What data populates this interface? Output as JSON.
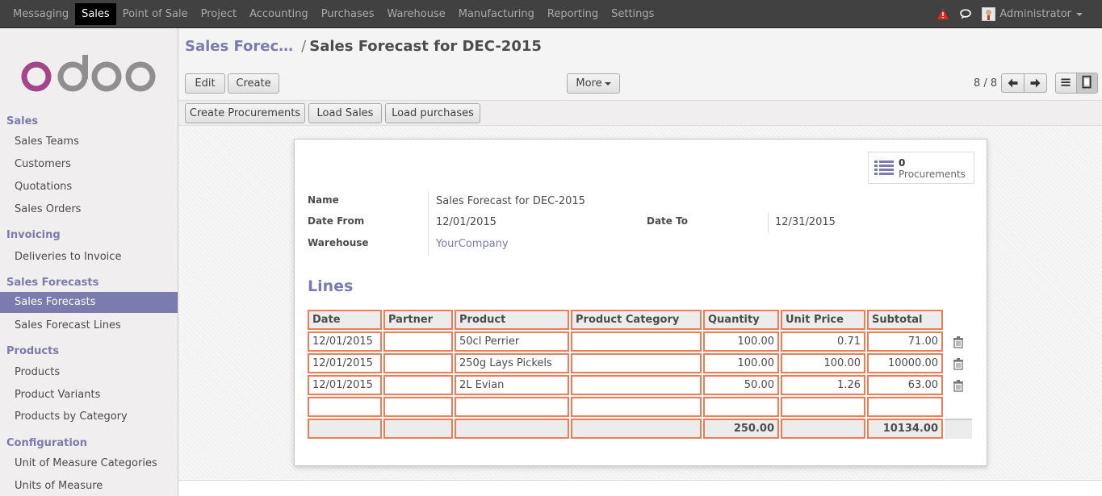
{
  "top_menu": {
    "items": [
      "Messaging",
      "Sales",
      "Point of Sale",
      "Project",
      "Accounting",
      "Purchases",
      "Warehouse",
      "Manufacturing",
      "Reporting",
      "Settings"
    ],
    "active": "Sales",
    "user": "Administrator"
  },
  "sidebar": {
    "sections": [
      {
        "title": "Sales",
        "items": [
          "Sales Teams",
          "Customers",
          "Quotations",
          "Sales Orders"
        ]
      },
      {
        "title": "Invoicing",
        "items": [
          "Deliveries to Invoice"
        ]
      },
      {
        "title": "Sales Forecasts",
        "items": [
          "Sales Forecasts",
          "Sales Forecast Lines"
        ]
      },
      {
        "title": "Products",
        "items": [
          "Products",
          "Product Variants",
          "Products by Category"
        ]
      },
      {
        "title": "Configuration",
        "items": [
          "Unit of Measure Categories",
          "Units of Measure"
        ]
      }
    ],
    "active_item": "Sales Forecasts"
  },
  "breadcrumb": {
    "parent": "Sales Forec…",
    "separator": "/",
    "current": "Sales Forecast for DEC-2015"
  },
  "toolbar": {
    "edit_label": "Edit",
    "create_label": "Create",
    "more_label": "More",
    "pager": "8 / 8"
  },
  "actions": {
    "create_procurements": "Create Procurements",
    "load_sales": "Load Sales",
    "load_purchases": "Load purchases"
  },
  "stat_button": {
    "count": "0",
    "label": "Procurements"
  },
  "form": {
    "name_label": "Name",
    "name_value": "Sales Forecast for DEC-2015",
    "date_from_label": "Date From",
    "date_from_value": "12/01/2015",
    "date_to_label": "Date To",
    "date_to_value": "12/31/2015",
    "warehouse_label": "Warehouse",
    "warehouse_value": "YourCompany"
  },
  "lines": {
    "title": "Lines",
    "columns": [
      "Date",
      "Partner",
      "Product",
      "Product Category",
      "Quantity",
      "Unit Price",
      "Subtotal"
    ],
    "rows": [
      {
        "date": "12/01/2015",
        "partner": "",
        "product": "50cl Perrier",
        "category": "",
        "quantity": "100.00",
        "unit_price": "0.71",
        "subtotal": "71.00"
      },
      {
        "date": "12/01/2015",
        "partner": "",
        "product": "250g Lays Pickels",
        "category": "",
        "quantity": "100.00",
        "unit_price": "100.00",
        "subtotal": "10000.00"
      },
      {
        "date": "12/01/2015",
        "partner": "",
        "product": "2L Evian",
        "category": "",
        "quantity": "50.00",
        "unit_price": "1.26",
        "subtotal": "63.00"
      }
    ],
    "totals": {
      "quantity": "250.00",
      "subtotal": "10134.00"
    }
  },
  "colors": {
    "accent": "#7c7bad",
    "topbar": "#414141",
    "line_border": "#f07b55",
    "alert": "#e8271b"
  }
}
